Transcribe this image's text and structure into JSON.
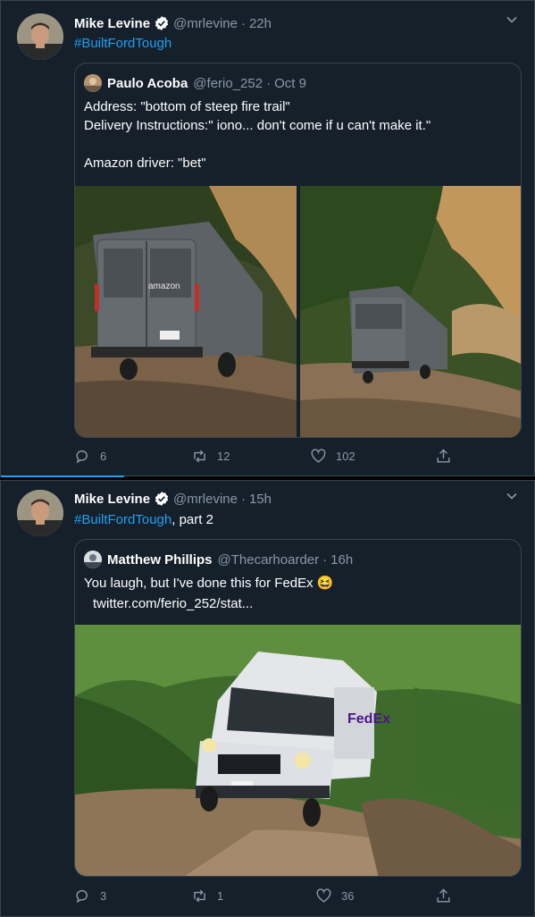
{
  "tweets": [
    {
      "author_name": "Mike Levine",
      "author_handle": "@mrlevine",
      "time": "22h",
      "body_hashtag": "#BuiltFordTough",
      "body_suffix": "",
      "quote": {
        "author_name": "Paulo Acoba",
        "author_handle": "@ferio_252",
        "time": "Oct 9",
        "text": "Address: \"bottom of steep fire trail\"\nDelivery Instructions:\" iono... don't come if u can't make it.\"\n\nAmazon driver: \"bet\""
      },
      "replies": "6",
      "retweets": "12",
      "likes": "102"
    },
    {
      "author_name": "Mike Levine",
      "author_handle": "@mrlevine",
      "time": "15h",
      "body_hashtag": "#BuiltFordTough",
      "body_suffix": ", part 2",
      "quote": {
        "author_name": "Matthew Phillips",
        "author_handle": "@Thecarhoarder",
        "time": "16h",
        "text": "You laugh, but I've done this for FedEx 😆",
        "link": "twitter.com/ferio_252/stat..."
      },
      "replies": "3",
      "retweets": "1",
      "likes": "36"
    }
  ],
  "separator": "·",
  "icons": {
    "verified": "verified-badge-icon",
    "menu": "chevron-down-icon",
    "reply": "reply-icon",
    "retweet": "retweet-icon",
    "like": "heart-icon",
    "share": "share-icon"
  },
  "colors": {
    "background": "#15202b",
    "border": "#38444d",
    "accent": "#1da1f2",
    "muted": "#8899a6"
  },
  "photo_text": {
    "amazon_logo": "amazon",
    "fedex_logo": "FedEx"
  }
}
